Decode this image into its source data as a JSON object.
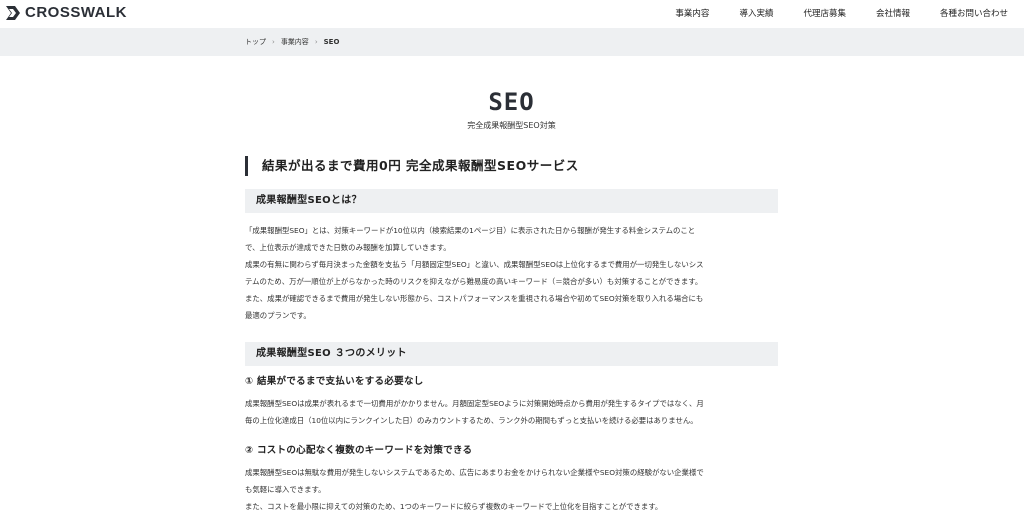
{
  "header": {
    "logo_text": "CROSSWALK",
    "nav": [
      "事業内容",
      "導入実績",
      "代理店募集",
      "会社情報",
      "各種お問い合わせ"
    ]
  },
  "breadcrumb": {
    "items": [
      "トップ",
      "事業内容",
      "SEO"
    ],
    "separator": "›"
  },
  "page": {
    "title": "SEO",
    "subtitle": "完全成果報酬型SEO対策"
  },
  "main": {
    "heading": "結果が出るまで費用0円 完全成果報酬型SEOサービス",
    "section_about": {
      "heading": "成果報酬型SEOとは？",
      "lines": [
        "「成果報酬型SEO」とは、対策キーワードが10位以内（検索結果の1ページ目）に表示された日から報酬が発生する料金システムのこと",
        "で、上位表示が達成できた日数のみ報酬を加算していきます。",
        "成果の有無に関わらず毎月決まった金額を支払う「月額固定型SEO」と違い、成果報酬型SEOは上位化するまで費用が一切発生しないシス",
        "テムのため、万が一順位が上がらなかった時のリスクを抑えながら難易度の高いキーワード（＝競合が多い）も対策することができます。",
        "また、成果が確認できるまで費用が発生しない形態から、コストパフォーマンスを重視される場合や初めてSEO対策を取り入れる場合にも",
        "最適のプランです。"
      ]
    },
    "section_merits": {
      "heading": "成果報酬型SEO ３つのメリット",
      "merit1": {
        "title": "① 結果がでるまで支払いをする必要なし",
        "lines": [
          "成果報酬型SEOは成果が表れるまで一切費用がかかりません。月額固定型SEOように対策開始時点から費用が発生するタイプではなく、月",
          "毎の上位化達成日（10位以内にランクインした日）のみカウントするため、ランク外の期間もずっと支払いを続ける必要はありません。"
        ]
      },
      "merit2": {
        "title": "② コストの心配なく複数のキーワードを対策できる",
        "lines": [
          "成果報酬型SEOは無駄な費用が発生しないシステムであるため、広告にあまりお金をかけられない企業様やSEO対策の経験がない企業様で",
          "も気軽に導入できます。",
          "また、コストを最小限に抑えての対策のため、1つのキーワードに絞らず複数のキーワードで上位化を目指すことができます。"
        ]
      }
    }
  },
  "colors": {
    "accent": "#2b2f36",
    "band_bg": "#eef0f2",
    "text": "#333333"
  }
}
